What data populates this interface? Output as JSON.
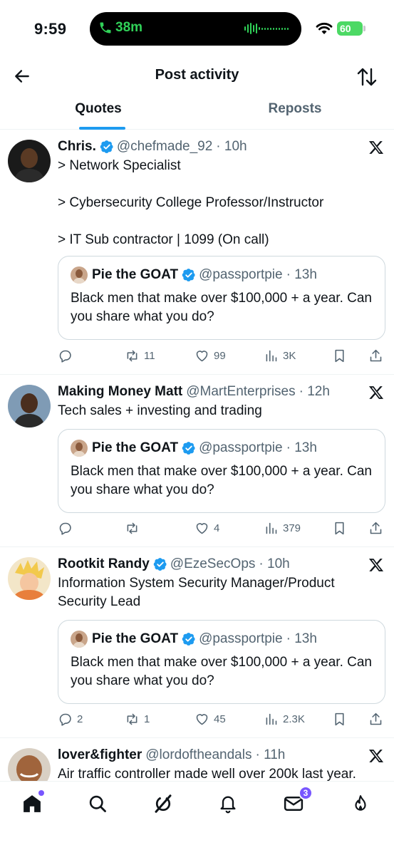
{
  "status_bar": {
    "time": "9:59",
    "call_duration": "38m",
    "battery": "60"
  },
  "header": {
    "title": "Post activity"
  },
  "tabs": [
    {
      "label": "Quotes",
      "active": true
    },
    {
      "label": "Reposts",
      "active": false
    }
  ],
  "quoted_post": {
    "name": "Pie the GOAT",
    "handle": "@passportpie",
    "time": "· 13h",
    "text": "Black men that make over $100,000 + a year. Can you share what you do?"
  },
  "posts": [
    {
      "name": "Chris.",
      "verified": true,
      "handle": "@chefmade_92",
      "time": "· 10h",
      "text": "> Network Specialist\n\n> Cybersecurity College Professor/Instructor\n\n> IT Sub contractor | 1099 (On call)",
      "replies": "",
      "reposts": "11",
      "likes": "99",
      "views": "3K"
    },
    {
      "name": "Making Money Matt",
      "verified": false,
      "handle": "@MartEnterprises",
      "time": "· 12h",
      "text": "Tech sales + investing and trading",
      "replies": "",
      "reposts": "",
      "likes": "4",
      "views": "379"
    },
    {
      "name": "Rootkit Randy",
      "verified": true,
      "handle": "@EzeSecOps",
      "time": "· 10h",
      "text": "Information System Security Manager/Product Security Lead",
      "replies": "2",
      "reposts": "1",
      "likes": "45",
      "views": "2.3K"
    },
    {
      "name": "lover&fighter",
      "verified": false,
      "handle": "@lordoftheandals",
      "time": "· 11h",
      "text": "Air traffic controller made well over 200k last year."
    }
  ],
  "bottom_nav": {
    "messages_badge": "3"
  },
  "colors": {
    "accent": "#1d9bf0",
    "badge": "#7856ff",
    "call_green": "#30d158"
  }
}
